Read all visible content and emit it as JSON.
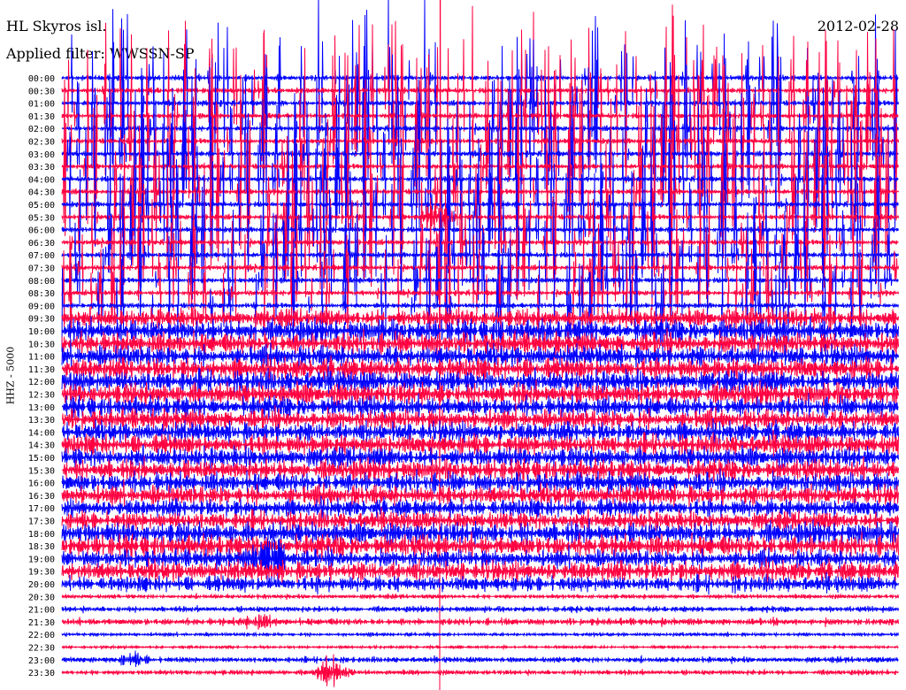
{
  "header": {
    "station": "HL Skyros isl.",
    "filter": "Applied filter: WWSSN-SP",
    "date": "2012-02-28"
  },
  "chart_data": {
    "type": "line",
    "title": "HL Skyros isl.",
    "subtitle": "Applied filter: WWSSN-SP",
    "date": "2012-02-28",
    "ylabel": "HHZ - 5000",
    "row_labels": [
      "00:00",
      "00:30",
      "01:00",
      "01:30",
      "02:00",
      "02:30",
      "03:00",
      "03:30",
      "04:00",
      "04:30",
      "05:00",
      "05:30",
      "06:00",
      "06:30",
      "07:00",
      "07:30",
      "08:00",
      "08:30",
      "09:00",
      "09:30",
      "10:00",
      "10:30",
      "11:00",
      "11:30",
      "12:00",
      "12:30",
      "13:00",
      "13:30",
      "14:00",
      "14:30",
      "15:00",
      "15:30",
      "16:00",
      "16:30",
      "17:00",
      "17:30",
      "18:00",
      "18:30",
      "19:00",
      "19:30",
      "20:00",
      "20:30",
      "21:00",
      "21:30",
      "22:00",
      "22:30",
      "23:00",
      "23:30"
    ],
    "series_colors": [
      "#0000ff",
      "#ff0040"
    ],
    "relative_activity": [
      0.9,
      0.9,
      0.9,
      0.9,
      0.9,
      0.9,
      0.9,
      0.9,
      0.9,
      0.9,
      0.9,
      0.9,
      0.8,
      0.7,
      0.6,
      0.6,
      0.6,
      0.6,
      0.6,
      0.25,
      0.3,
      0.3,
      0.3,
      0.3,
      0.3,
      0.3,
      0.28,
      0.28,
      0.28,
      0.28,
      0.28,
      0.28,
      0.28,
      0.28,
      0.25,
      0.25,
      0.3,
      0.3,
      0.25,
      0.28,
      0.22,
      0.06,
      0.08,
      0.1,
      0.05,
      0.04,
      0.08,
      0.07
    ],
    "events": [
      {
        "row": "05:30",
        "minute": 13.5,
        "strength": 1.0
      },
      {
        "row": "19:00",
        "minute": 7.5,
        "strength": 0.5
      },
      {
        "row": "23:30",
        "minute": 9.6,
        "strength": 1.0
      },
      {
        "row": "21:30",
        "minute": 7.0,
        "strength": 0.3
      },
      {
        "row": "23:00",
        "minute": 2.5,
        "strength": 0.3
      }
    ]
  }
}
